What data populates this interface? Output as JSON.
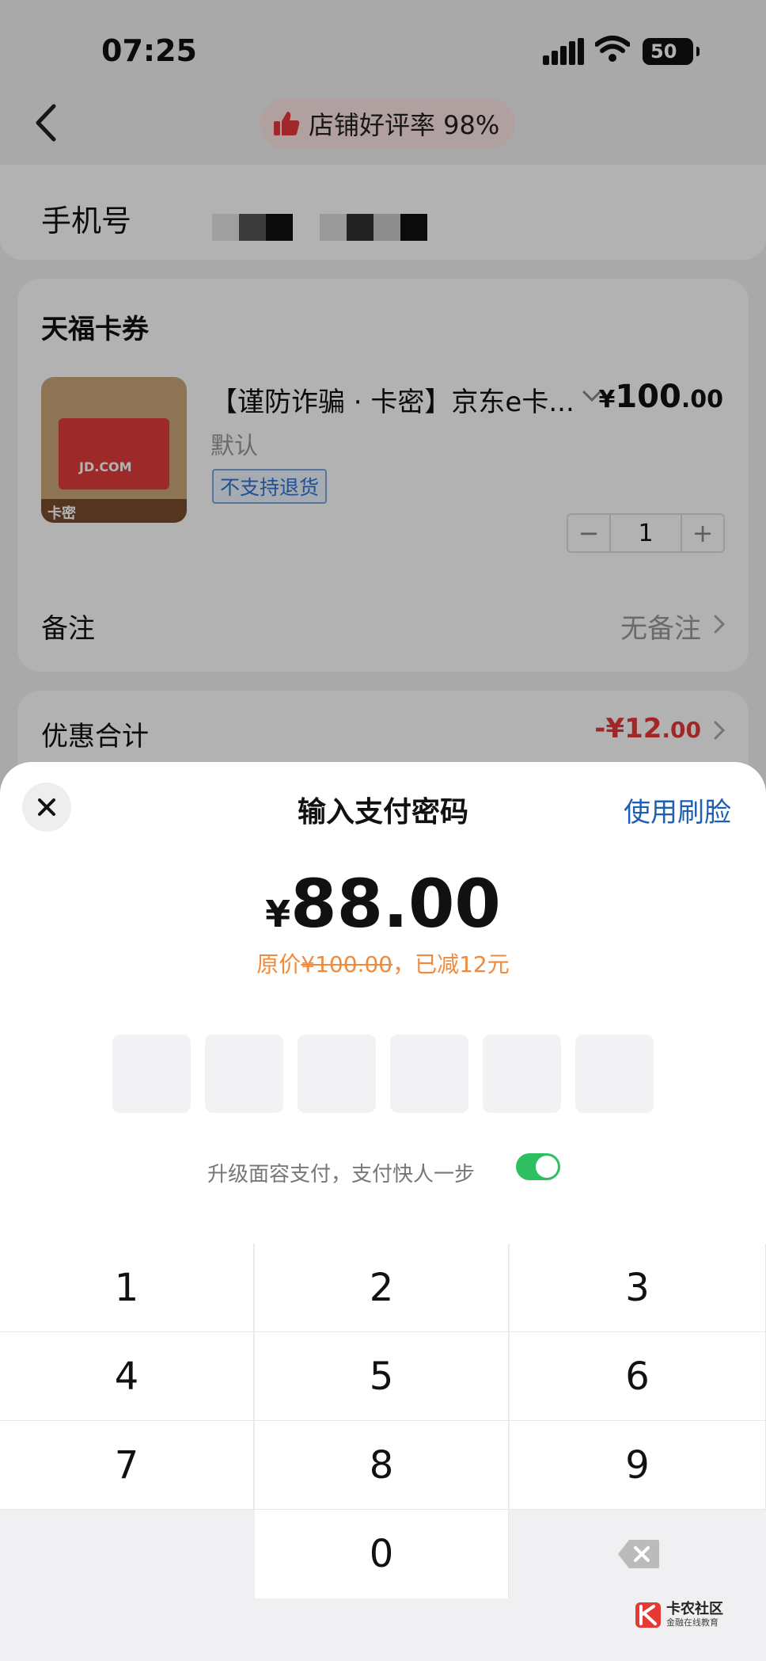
{
  "status_bar": {
    "time": "07:25",
    "battery": "50"
  },
  "header": {
    "rating_text": "店铺好评率 98%"
  },
  "order": {
    "phone_label": "手机号",
    "store_name": "天福卡券",
    "product_title": "【谨防诈骗 · 卡密】京东e卡...",
    "price_currency": "¥",
    "price_int": "100",
    "price_dec": ".00",
    "spec": "默认",
    "tag": "不支持退货",
    "quantity": "1",
    "minus": "−",
    "plus": "+",
    "remark_label": "备注",
    "remark_value": "无备注",
    "discount_label": "优惠合计",
    "discount_value_int": "-¥12",
    "discount_value_dec": ".00",
    "product_image": {
      "card_text": "JD.COM",
      "strip_text": "卡密"
    }
  },
  "payment_sheet": {
    "title": "输入支付密码",
    "face_pay_link": "使用刷脸",
    "amount_currency": "¥",
    "amount": "88.00",
    "orig_prefix": "原价",
    "orig_price": "¥100.00",
    "orig_suffix": "，已减12元",
    "upgrade_text": "升级面容支付，支付快人一步",
    "face_pay_toggle_on": true,
    "pin_length": 6
  },
  "keypad": {
    "keys": [
      "1",
      "2",
      "3",
      "4",
      "5",
      "6",
      "7",
      "8",
      "9",
      "0"
    ]
  },
  "watermark": {
    "title": "卡农社区",
    "subtitle": "金融在线教育"
  },
  "colors": {
    "accent_blue": "#1e5fb3",
    "discount_red": "#e53935",
    "orig_orange": "#f08a3c",
    "toggle_green": "#2fbf63"
  }
}
